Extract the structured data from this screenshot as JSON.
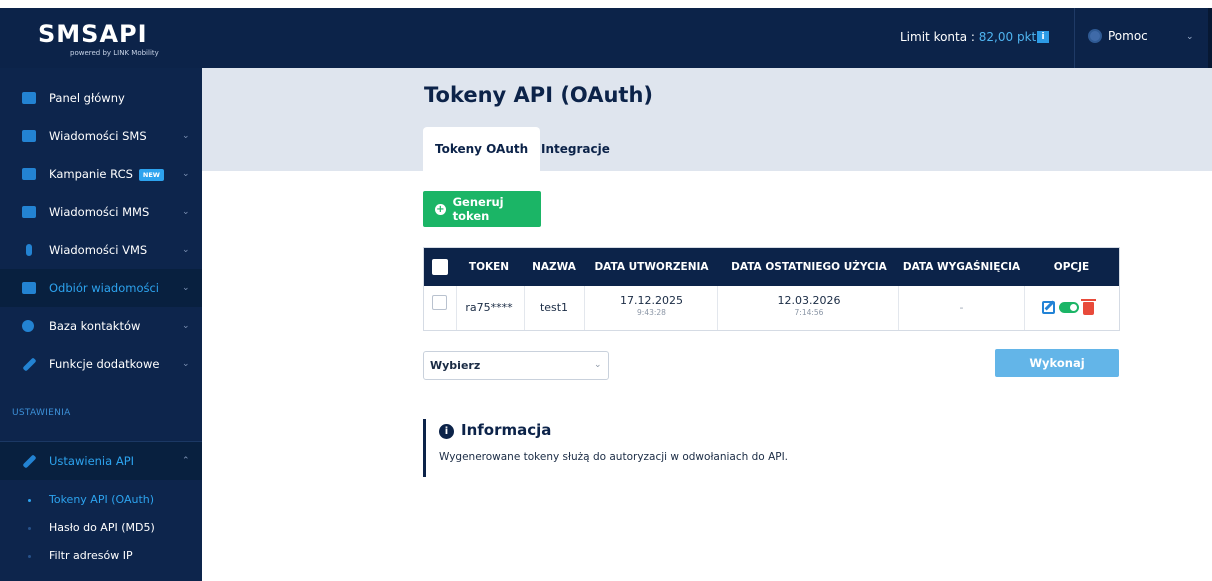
{
  "brand": {
    "logo": "SMSAPI",
    "tagline": "powered by LINK Mobility"
  },
  "topbar": {
    "limit_label": "Limit konta :",
    "limit_value": "82,00 pkt",
    "info_glyph": "i",
    "help_label": "Pomoc"
  },
  "sidebar": {
    "items": [
      {
        "label": "Panel główny",
        "icon": "home-icon",
        "chevron": false
      },
      {
        "label": "Wiadomości SMS",
        "icon": "sms-icon",
        "chevron": true
      },
      {
        "label": "Kampanie RCS",
        "icon": "rcs-icon",
        "chevron": true,
        "badge": "NEW"
      },
      {
        "label": "Wiadomości MMS",
        "icon": "mms-icon",
        "chevron": true
      },
      {
        "label": "Wiadomości VMS",
        "icon": "vms-icon",
        "chevron": true
      },
      {
        "label": "Odbiór wiadomości",
        "icon": "inbox-icon",
        "chevron": true
      },
      {
        "label": "Baza kontaktów",
        "icon": "contacts-icon",
        "chevron": true
      },
      {
        "label": "Funkcje dodatkowe",
        "icon": "wrench-icon",
        "chevron": true
      }
    ],
    "section_title": "USTAWIENIA",
    "settings_item": {
      "label": "Ustawienia API",
      "icon": "wrench-icon"
    },
    "sub_items": [
      {
        "label": "Tokeny API (OAuth)"
      },
      {
        "label": "Hasło do API (MD5)"
      },
      {
        "label": "Filtr adresów IP"
      }
    ]
  },
  "page": {
    "title": "Tokeny API (OAuth)",
    "tabs": [
      "Tokeny OAuth",
      "Integracje"
    ],
    "generate_button": "Generuj token"
  },
  "table": {
    "headers": [
      "TOKEN",
      "NAZWA",
      "DATA UTWORZENIA",
      "DATA OSTATNIEGO UŻYCIA",
      "DATA WYGAŚNIĘCIA",
      "OPCJE"
    ],
    "rows": [
      {
        "token": "ra75****",
        "name": "test1",
        "created_date": "17.12.2025",
        "created_time": "9:43:28",
        "last_used_date": "12.03.2026",
        "last_used_time": "7:14:56",
        "expires": "-"
      }
    ]
  },
  "bulk": {
    "select_value": "Wybierz",
    "execute_button": "Wykonaj"
  },
  "info": {
    "icon_glyph": "i",
    "title": "Informacja",
    "text": "Wygenerowane tokeny służą do autoryzacji w odwołaniach do API."
  },
  "colors": {
    "navy": "#0c2349",
    "accent_blue": "#2da3ee",
    "green": "#1bb566",
    "red": "#e84a3a",
    "header_band": "#dfe5ee"
  }
}
